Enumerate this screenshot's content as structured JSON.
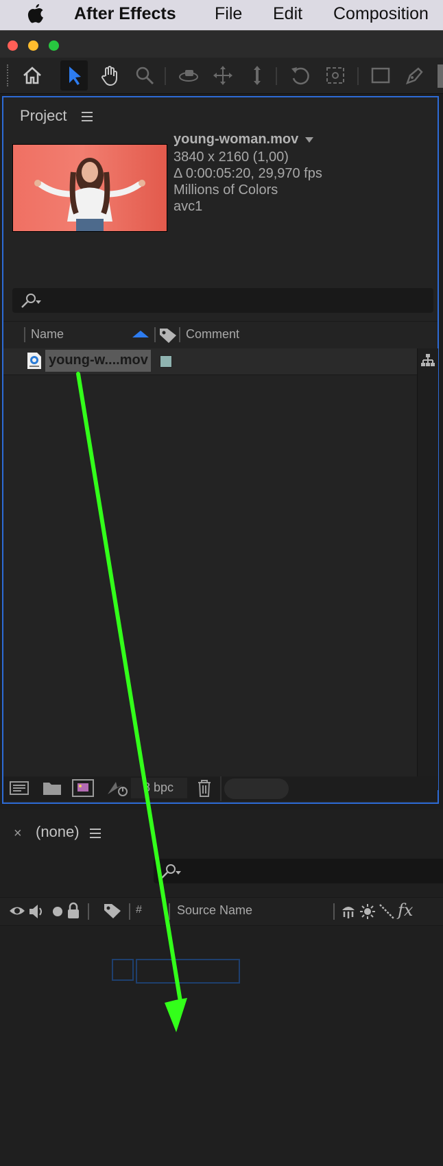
{
  "menubar": {
    "apple_icon": "apple-logo",
    "app_name": "After Effects",
    "items": [
      "File",
      "Edit",
      "Composition"
    ]
  },
  "window": {
    "traffic_lights": [
      "#ff5f57",
      "#febc2e",
      "#28c840"
    ]
  },
  "toolbar": {
    "tools": [
      "home-icon",
      "selection-tool-icon",
      "hand-tool-icon",
      "zoom-tool-icon",
      "orbit-camera-icon",
      "pan-camera-icon",
      "dolly-camera-icon",
      "rotation-tool-icon",
      "anchor-point-tool-icon",
      "rectangle-tool-icon",
      "pen-tool-icon"
    ]
  },
  "project_panel": {
    "title": "Project",
    "preview": {
      "filename": "young-woman.mov",
      "dimensions": "3840 x 2160 (1,00)",
      "duration": "Δ 0:00:05:20, 29,970 fps",
      "colors": "Millions of Colors",
      "codec": "avc1"
    },
    "search": {
      "placeholder": ""
    },
    "columns": {
      "name": "Name",
      "comment": "Comment"
    },
    "items": [
      {
        "name": "young-w....mov",
        "label_color": "#8fb3b0",
        "selected": true
      }
    ],
    "footer": {
      "bpc": "8 bpc"
    }
  },
  "timeline_panel": {
    "title": "(none)",
    "close_icon": "close-icon",
    "columns": {
      "number": "#",
      "source_name": "Source Name"
    }
  },
  "annotation": {
    "arrow_color": "#33ff1a",
    "type": "drag-arrow"
  }
}
